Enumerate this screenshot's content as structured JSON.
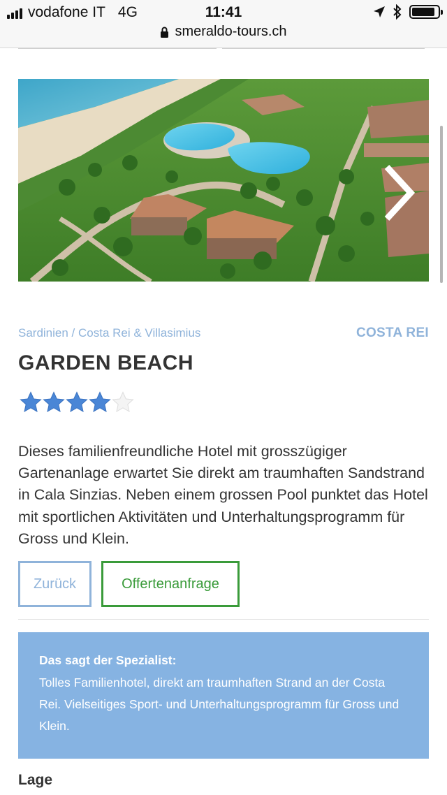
{
  "status_bar": {
    "carrier": "vodafone IT",
    "network": "4G",
    "time": "11:41",
    "battery_level": 0.9
  },
  "browser": {
    "url": "smeraldo-tours.ch"
  },
  "gallery": {
    "image_alt": "Aerial view of hotel resort with pools, palm trees and beach",
    "next_icon": "chevron-right-icon"
  },
  "hotel": {
    "breadcrumb": "Sardinien / Costa Rei & Villasimius",
    "region": "COSTA REI",
    "name": "GARDEN BEACH",
    "rating": 4,
    "rating_max": 5,
    "description": "Dieses familienfreundliche Hotel mit grosszügiger Gartenanlage erwartet Sie direkt am traumhaften Sandstrand in Cala Sinzias. Neben einem grossen Pool punktet das Hotel mit sportlichen Aktivitäten und Unterhaltungsprogramm für Gross und Klein."
  },
  "actions": {
    "back_label": "Zurück",
    "offer_label": "Offertenanfrage"
  },
  "specialist": {
    "heading": "Das sagt der Spezialist:",
    "text": "Tolles Familienhotel, direkt am traumhaften Strand an der Costa Rei. Vielseitiges Sport- und Unterhaltungsprogramm für Gross und Klein."
  },
  "section": {
    "lage_title": "Lage"
  },
  "colors": {
    "accent_blue": "#8fb3da",
    "accent_green": "#3a9b3a",
    "specialist_bg": "#86b3e2",
    "star_blue": "#4a86d6"
  }
}
